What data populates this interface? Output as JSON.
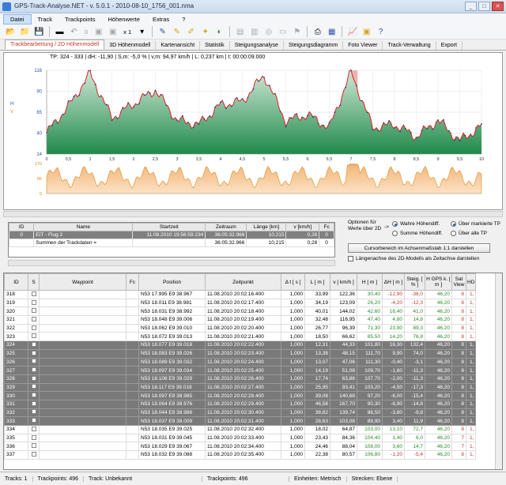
{
  "title": "GPS-Track-Analyse.NET  -  v. 5.0.1  -  2010-08-10_1756_001.nma",
  "menu": [
    "Datei",
    "Track",
    "Trackpoints",
    "Höhenwerte",
    "Extras",
    "?"
  ],
  "toolbar": {
    "zoom": "x 1"
  },
  "tabs": [
    "Trackbearbeitung / 2D Höhenmodell",
    "3D Höhenmodell",
    "Kartenansicht",
    "Statistik",
    "Steigungsanalyse",
    "Steigungsdiagramm",
    "Foto Viewer",
    "Track-Verwaltung",
    "Export"
  ],
  "chart": {
    "info": "TP: 324 - 333 | dH: -11,90  | S,m: -5,0 % | v,m: 94,97 km/h | L: 0,237 km | t: 00:00:09.000",
    "yticks": [
      "116",
      "90",
      "65",
      "40",
      "14"
    ],
    "xticks": [
      "0",
      "0,5",
      "1",
      "1,5",
      "2",
      "2,5",
      "3",
      "3,5",
      "4",
      "4,5",
      "5",
      "5,5",
      "6",
      "6,5",
      "7",
      "7,5",
      "8",
      "8,5",
      "9",
      "9,5",
      "10"
    ],
    "axisH": "H",
    "axisV": "V",
    "vticks": [
      "170",
      "85",
      "0"
    ]
  },
  "chart_data": {
    "type": "area",
    "xlabel": "",
    "ylabel": "H",
    "ylim": [
      14,
      116
    ],
    "x": [
      0,
      0.5,
      1,
      1.5,
      2,
      2.5,
      3,
      3.5,
      4,
      4.5,
      5,
      5.5,
      6,
      6.5,
      7,
      7.5,
      8,
      8.5,
      9,
      9.5,
      10
    ],
    "series": [
      {
        "name": "H",
        "values": [
          40,
          72,
          112,
          58,
          75,
          92,
          55,
          50,
          74,
          78,
          110,
          54,
          62,
          46,
          114,
          46,
          50,
          35,
          55,
          30,
          48
        ]
      }
    ]
  },
  "summary": {
    "headers": [
      "ID",
      "Name",
      "Startzeit",
      "Zeitraum",
      "Länge [km]",
      "v [km/h]",
      "Fc"
    ],
    "rows": [
      [
        "0",
        "EIT - Flug 2",
        "11.08.2010 19:56:59.234",
        "36:05:32.966",
        "10,215",
        "0,28",
        "0"
      ],
      [
        "",
        "Summen der Trackdaten =",
        "",
        "36:05:32.966",
        "10,215",
        "0,28",
        "0"
      ]
    ]
  },
  "options": {
    "label": "Optionen für Werte über 2D",
    "arrow": "->",
    "r1": "Wahre Höhendiff.",
    "r2": "Summe Höhendiff.",
    "r3": "Über markierte TP",
    "r4": "Über alle TP",
    "button": "Cursorbereich im Achsenmaßstab 1:1 darstellen",
    "check": "Längenachse des 2D-Modells als Zeitachse darstellen"
  },
  "grid": {
    "headers": [
      "ID",
      "S",
      "Waypoint",
      "Fc",
      "Position",
      "Zeitpunkt",
      "Δ t [ s ]",
      "L [ m ]",
      "v [ km/h ]",
      "H [ m ]",
      "ΔH [ m ]",
      "Steig. [ % ]",
      "H GPS k. [ m ]",
      "Sat View",
      "HD"
    ],
    "rows": [
      [
        "318",
        "",
        "",
        "",
        "N53 17.995 E9 38.967",
        "11.08.2010 20:02:16.400",
        "1,000",
        "33,99",
        "122,36",
        "30,40",
        "-12,90",
        "-38,0",
        "46,20",
        "8",
        "1,"
      ],
      [
        "319",
        "",
        "",
        "",
        "N53 18.011 E9 38.981",
        "11.08.2010 20:02:17.400",
        "1,000",
        "34,19",
        "123,09",
        "26,20",
        "-4,20",
        "-12,3",
        "46,20",
        "8",
        "1,"
      ],
      [
        "320",
        "",
        "",
        "",
        "N53 18.031 E9 38.992",
        "11.08.2010 20:02:18.400",
        "1,000",
        "40,01",
        "144,02",
        "42,60",
        "16,40",
        "41,0",
        "46,20",
        "8",
        "1,"
      ],
      [
        "321",
        "",
        "",
        "",
        "N53 18.048 E9 39.006",
        "11.08.2010 20:02:19.400",
        "1,000",
        "32,48",
        "116,95",
        "47,40",
        "4,80",
        "14,8",
        "46,20",
        "8",
        "1,"
      ],
      [
        "322",
        "",
        "",
        "",
        "N53 18.062 E9 39.010",
        "11.08.2010 20:02:20.400",
        "1,000",
        "26,77",
        "96,39",
        "71,30",
        "23,90",
        "89,3",
        "46,20",
        "8",
        "1,"
      ],
      [
        "323",
        "",
        "",
        "",
        "N53 18.072 E9 39.013",
        "11.08.2010 20:02:21.400",
        "1,000",
        "18,50",
        "66,62",
        "85,50",
        "14,20",
        "76,8",
        "46,20",
        "8",
        "1,"
      ],
      [
        "324",
        "",
        "",
        "",
        "N53 18.077 E9 39.018",
        "11.08.2010 20:02:22.400",
        "1,000",
        "12,31",
        "44,33",
        "101,80",
        "16,30",
        "132,4",
        "46,20",
        "8",
        "1,"
      ],
      [
        "325",
        "",
        "",
        "",
        "N53 18.083 E9 39.026",
        "11.08.2010 20:02:23.400",
        "1,000",
        "13,38",
        "48,15",
        "111,70",
        "9,90",
        "74,0",
        "46,20",
        "8",
        "1,"
      ],
      [
        "326",
        "",
        "",
        "",
        "N53 18.089 E9 39.032",
        "11.08.2010 20:02:24.400",
        "1,000",
        "13,07",
        "47,06",
        "111,30",
        "-0,40",
        "-3,1",
        "46,20",
        "8",
        "1,"
      ],
      [
        "327",
        "",
        "",
        "",
        "N53 18.097 E9 39.034",
        "11.08.2010 20:02:25.400",
        "1,000",
        "14,19",
        "51,08",
        "109,70",
        "-1,60",
        "-11,3",
        "46,20",
        "8",
        "1,"
      ],
      [
        "328",
        "",
        "",
        "",
        "N53 18.106 E9 39.029",
        "11.08.2010 20:02:26.400",
        "1,000",
        "17,74",
        "63,86",
        "107,70",
        "-2,00",
        "-11,3",
        "46,20",
        "8",
        "1,"
      ],
      [
        "329",
        "",
        "",
        "",
        "N53 18.117 E9 39.018",
        "11.08.2010 20:02:27.400",
        "1,000",
        "25,95",
        "93,41",
        "103,20",
        "-4,50",
        "-17,3",
        "46,20",
        "8",
        "1,"
      ],
      [
        "330",
        "",
        "",
        "",
        "N53 18.097 E9 38.985",
        "11.08.2010 20:02:28.400",
        "1,000",
        "39,08",
        "140,68",
        "97,20",
        "-6,00",
        "-15,4",
        "46,20",
        "8",
        "1,"
      ],
      [
        "331",
        "",
        "",
        "",
        "N53 18.064 E9 38.976",
        "11.08.2010 20:02:29.400",
        "1,000",
        "46,58",
        "167,70",
        "90,30",
        "-6,90",
        "-14,8",
        "46,20",
        "8",
        "1,"
      ],
      [
        "332",
        "",
        "",
        "",
        "N53 18.044 E9 38.986",
        "11.08.2010 20:02:30.400",
        "1,000",
        "38,82",
        "139,74",
        "86,50",
        "-3,80",
        "-9,8",
        "46,20",
        "8",
        "1,"
      ],
      [
        "333",
        "",
        "",
        "",
        "N53 18.037 E9 39.009",
        "11.08.2010 20:02:31.400",
        "1,000",
        "28,63",
        "103,08",
        "89,90",
        "3,40",
        "11,9",
        "46,20",
        "8",
        "1,"
      ],
      [
        "334",
        "",
        "",
        "",
        "N53 18.035 E9 39.025",
        "11.08.2010 20:02:32.400",
        "1,000",
        "18,02",
        "64,87",
        "103,00",
        "13,10",
        "72,7",
        "46,20",
        "8",
        "1,"
      ],
      [
        "335",
        "",
        "",
        "",
        "N53 18.031 E9 39.045",
        "11.08.2010 20:02:33.400",
        "1,000",
        "23,43",
        "84,36",
        "104,40",
        "1,40",
        "6,0",
        "46,20",
        "7",
        "1,"
      ],
      [
        "336",
        "",
        "",
        "",
        "N53 18.029 E9 39.067",
        "11.08.2010 20:02:34.400",
        "1,000",
        "24,46",
        "88,04",
        "108,00",
        "3,60",
        "14,7",
        "46,20",
        "7",
        "1,"
      ],
      [
        "337",
        "",
        "",
        "",
        "N53 18.032 E9 39.088",
        "11.08.2010 20:02:35.400",
        "1,000",
        "22,38",
        "80,57",
        "106,80",
        "-1,20",
        "-5,4",
        "46,20",
        "8",
        "1,"
      ]
    ]
  },
  "status": [
    "Tracks: 1",
    "Trackpoints: 496",
    "Track: Unbekannt",
    "Trackpoints: 496",
    "Einheiten: Metrisch",
    "Strecken: Ebene"
  ]
}
